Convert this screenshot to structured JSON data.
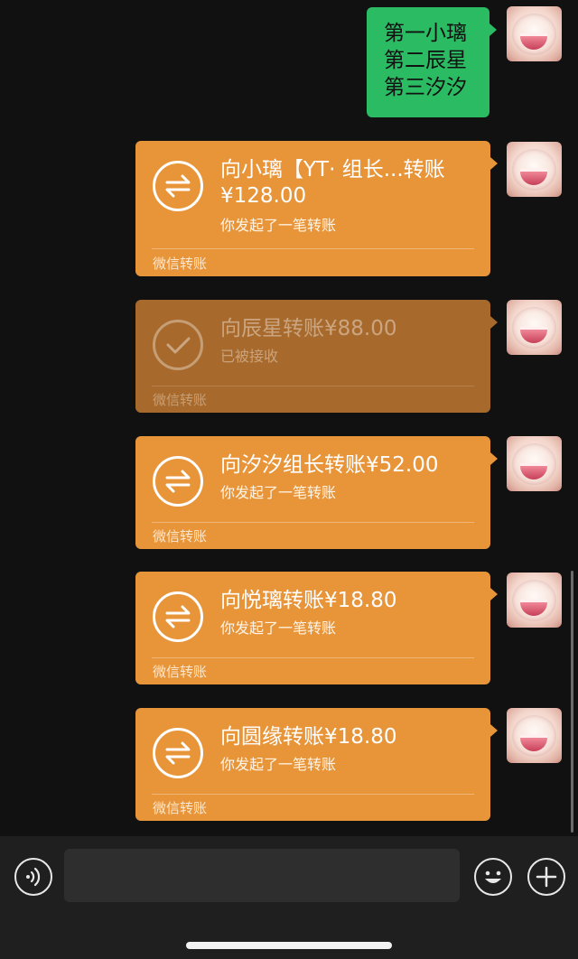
{
  "text_message": {
    "lines": [
      "第一小璃",
      "第二辰星",
      "第三汐汐"
    ]
  },
  "transfers": [
    {
      "title": "向小璃【YT· 组长...转账",
      "amount": "¥128.00",
      "status": "你发起了一笔转账",
      "footer": "微信转账",
      "icon": "transfer-arrows-icon",
      "state": "sent"
    },
    {
      "title": "向辰星转账¥88.00",
      "status": "已被接收",
      "footer": "微信转账",
      "icon": "checkmark-icon",
      "state": "received"
    },
    {
      "title": "向汐汐组长转账¥52.00",
      "status": "你发起了一笔转账",
      "footer": "微信转账",
      "icon": "transfer-arrows-icon",
      "state": "sent"
    },
    {
      "title": "向悦璃转账¥18.80",
      "status": "你发起了一笔转账",
      "footer": "微信转账",
      "icon": "transfer-arrows-icon",
      "state": "sent"
    },
    {
      "title": "向圆缘转账¥18.80",
      "status": "你发起了一笔转账",
      "footer": "微信转账",
      "icon": "transfer-arrows-icon",
      "state": "sent"
    }
  ],
  "input_bar": {
    "voice_icon": "voice-icon",
    "emoji_icon": "emoji-icon",
    "more_icon": "plus-icon"
  },
  "colors": {
    "chat_background": "#111111",
    "text_bubble": "#2bbb63",
    "transfer_sent": "#e8953a",
    "transfer_received": "#a86a2c",
    "input_bar": "#1f1f1f"
  }
}
